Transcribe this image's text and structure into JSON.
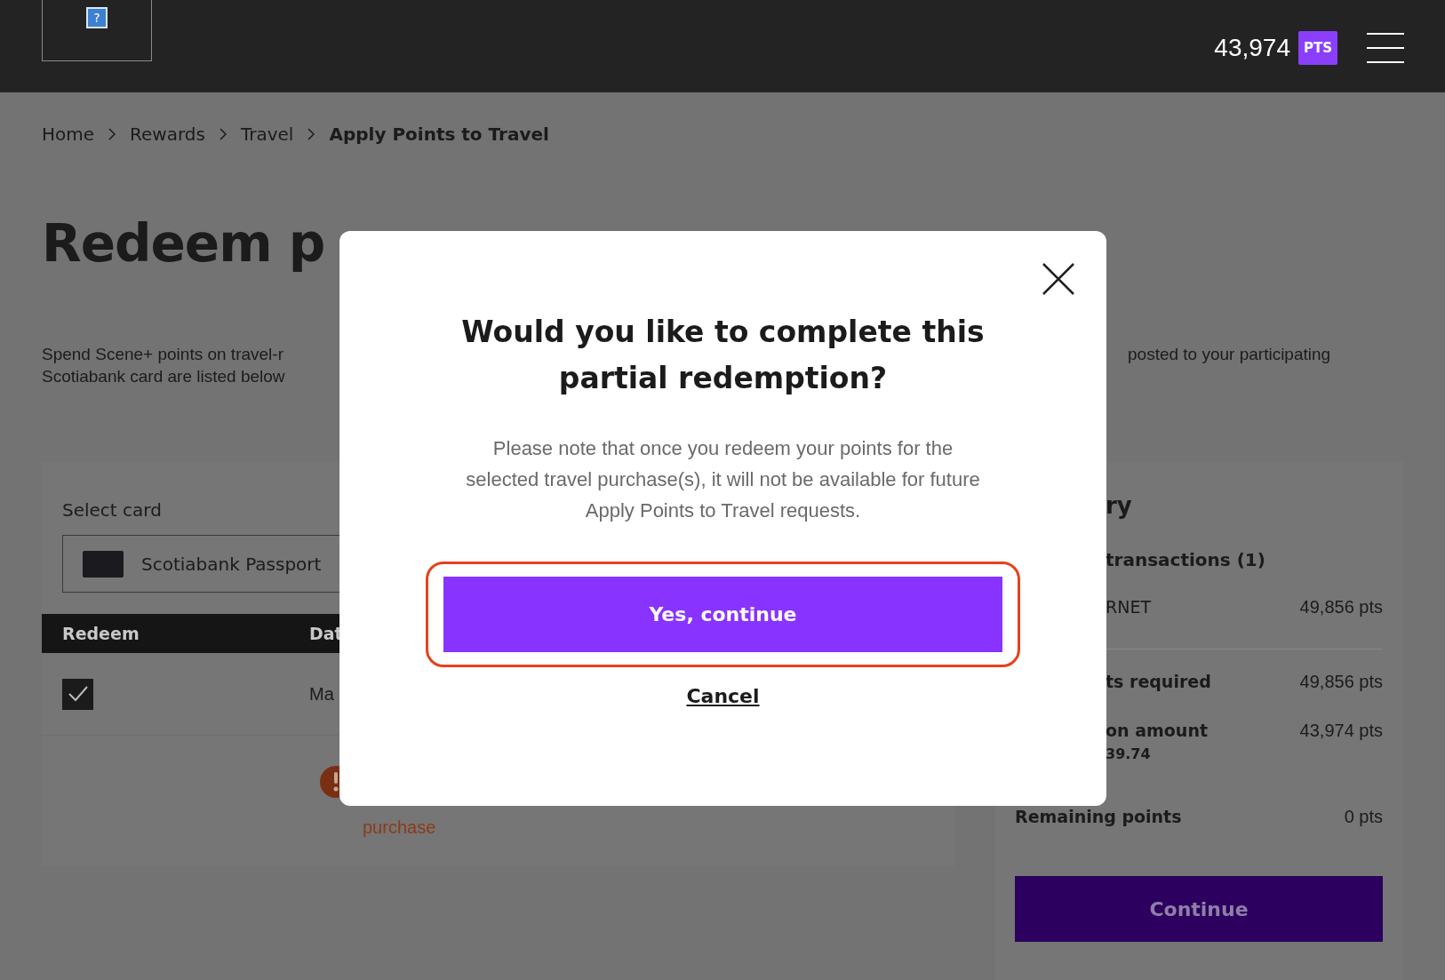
{
  "header": {
    "logo": {
      "glyph": "?"
    },
    "points": "43,974",
    "points_unit": "PTS"
  },
  "breadcrumb": [
    {
      "label": "Home",
      "current": false
    },
    {
      "label": "Rewards",
      "current": false
    },
    {
      "label": "Travel",
      "current": false
    },
    {
      "label": "Apply Points to Travel",
      "current": true
    }
  ],
  "page_title": "Redeem p",
  "intro": {
    "left_lines": [
      "Spend Scene+ points on travel-r",
      "Scotiabank card are listed below"
    ],
    "right_lines": [
      "posted to your participating"
    ]
  },
  "card_select": {
    "label": "Select card",
    "value": "Scotiabank Passport"
  },
  "table": {
    "columns": [
      "Redeem",
      "Dat"
    ],
    "rows": [
      {
        "checked": true,
        "date": "Ma"
      }
    ]
  },
  "warning": {
    "text": "purchase"
  },
  "summary": {
    "title": "ry",
    "section": "transactions (1)",
    "rows": [
      {
        "kind": "item",
        "label": "RNET",
        "value": "49,856 pts"
      },
      {
        "kind": "divider"
      },
      {
        "kind": "bold",
        "label": "ts required",
        "value": "49,856 pts"
      },
      {
        "kind": "bold",
        "label": "on amount",
        "value": "43,974 pts",
        "sub": "39.74"
      },
      {
        "kind": "total",
        "label": "Remaining points",
        "value": "0 pts"
      }
    ],
    "button": "Continue"
  },
  "modal": {
    "title": "Would you like to complete this partial redemption?",
    "body": "Please note that once you redeem your points for the selected travel purchase(s), it will not be available for future Apply Points to Travel requests.",
    "primary": {
      "label": "Yes, continue",
      "highlighted": true
    },
    "cancel": "Cancel"
  }
}
